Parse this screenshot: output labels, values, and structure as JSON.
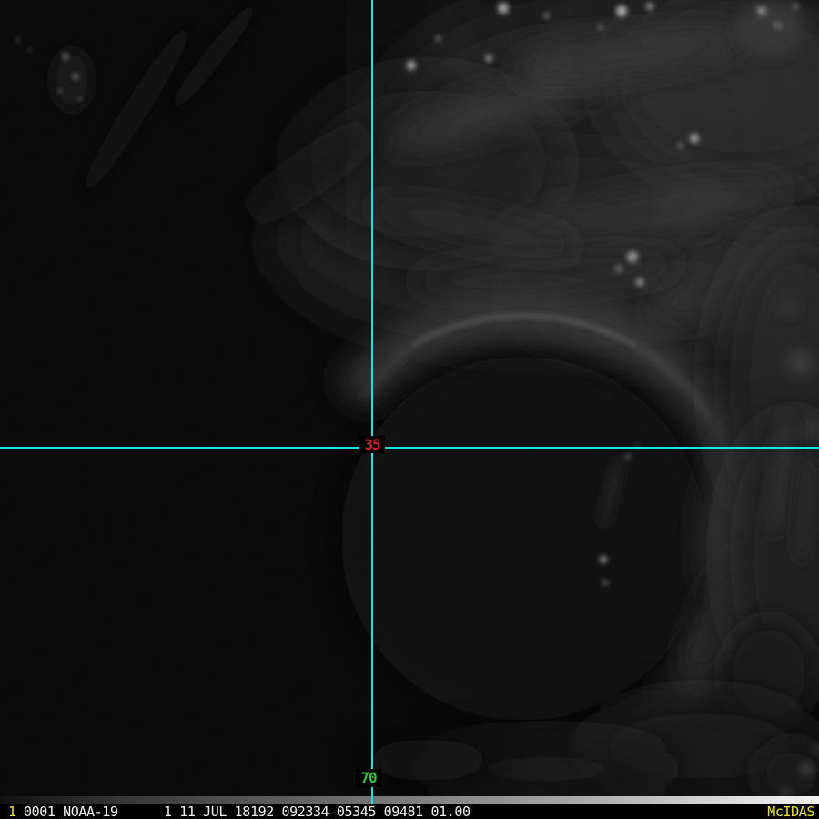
{
  "crosshair": {
    "line_color": "#17e3e3",
    "center_label": {
      "text": "35",
      "color": "#d42020"
    },
    "bottom_label": {
      "text": "70",
      "color": "#2bc838"
    }
  },
  "status_bar": {
    "frame_number": "1",
    "image_id": "0001 NOAA-19",
    "image_info": "1 11 JUL 18192 092334 05345 09481 01.00",
    "brand": "McIDAS",
    "accent_color": "#f0e60a",
    "text_color": "#f2f2f2",
    "background": "#000000"
  }
}
